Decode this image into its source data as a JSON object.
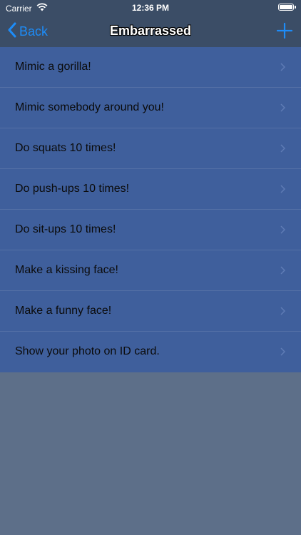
{
  "status_bar": {
    "carrier": "Carrier",
    "time": "12:36 PM",
    "battery_level": 1.0
  },
  "nav": {
    "back_label": "Back",
    "title": "Embarrassed"
  },
  "list": {
    "items": [
      {
        "label": "Mimic a gorilla!"
      },
      {
        "label": "Mimic somebody around you!"
      },
      {
        "label": "Do squats 10 times!"
      },
      {
        "label": "Do push-ups 10 times!"
      },
      {
        "label": "Do sit-ups 10 times!"
      },
      {
        "label": "Make a kissing face!"
      },
      {
        "label": "Make a funny face!"
      },
      {
        "label": "Show your photo on ID card."
      }
    ]
  },
  "colors": {
    "accent": "#1d8cf8",
    "nav_bg": "#3b4d66",
    "list_bg": "#3f5f9c",
    "page_bg": "#5d6f89"
  }
}
